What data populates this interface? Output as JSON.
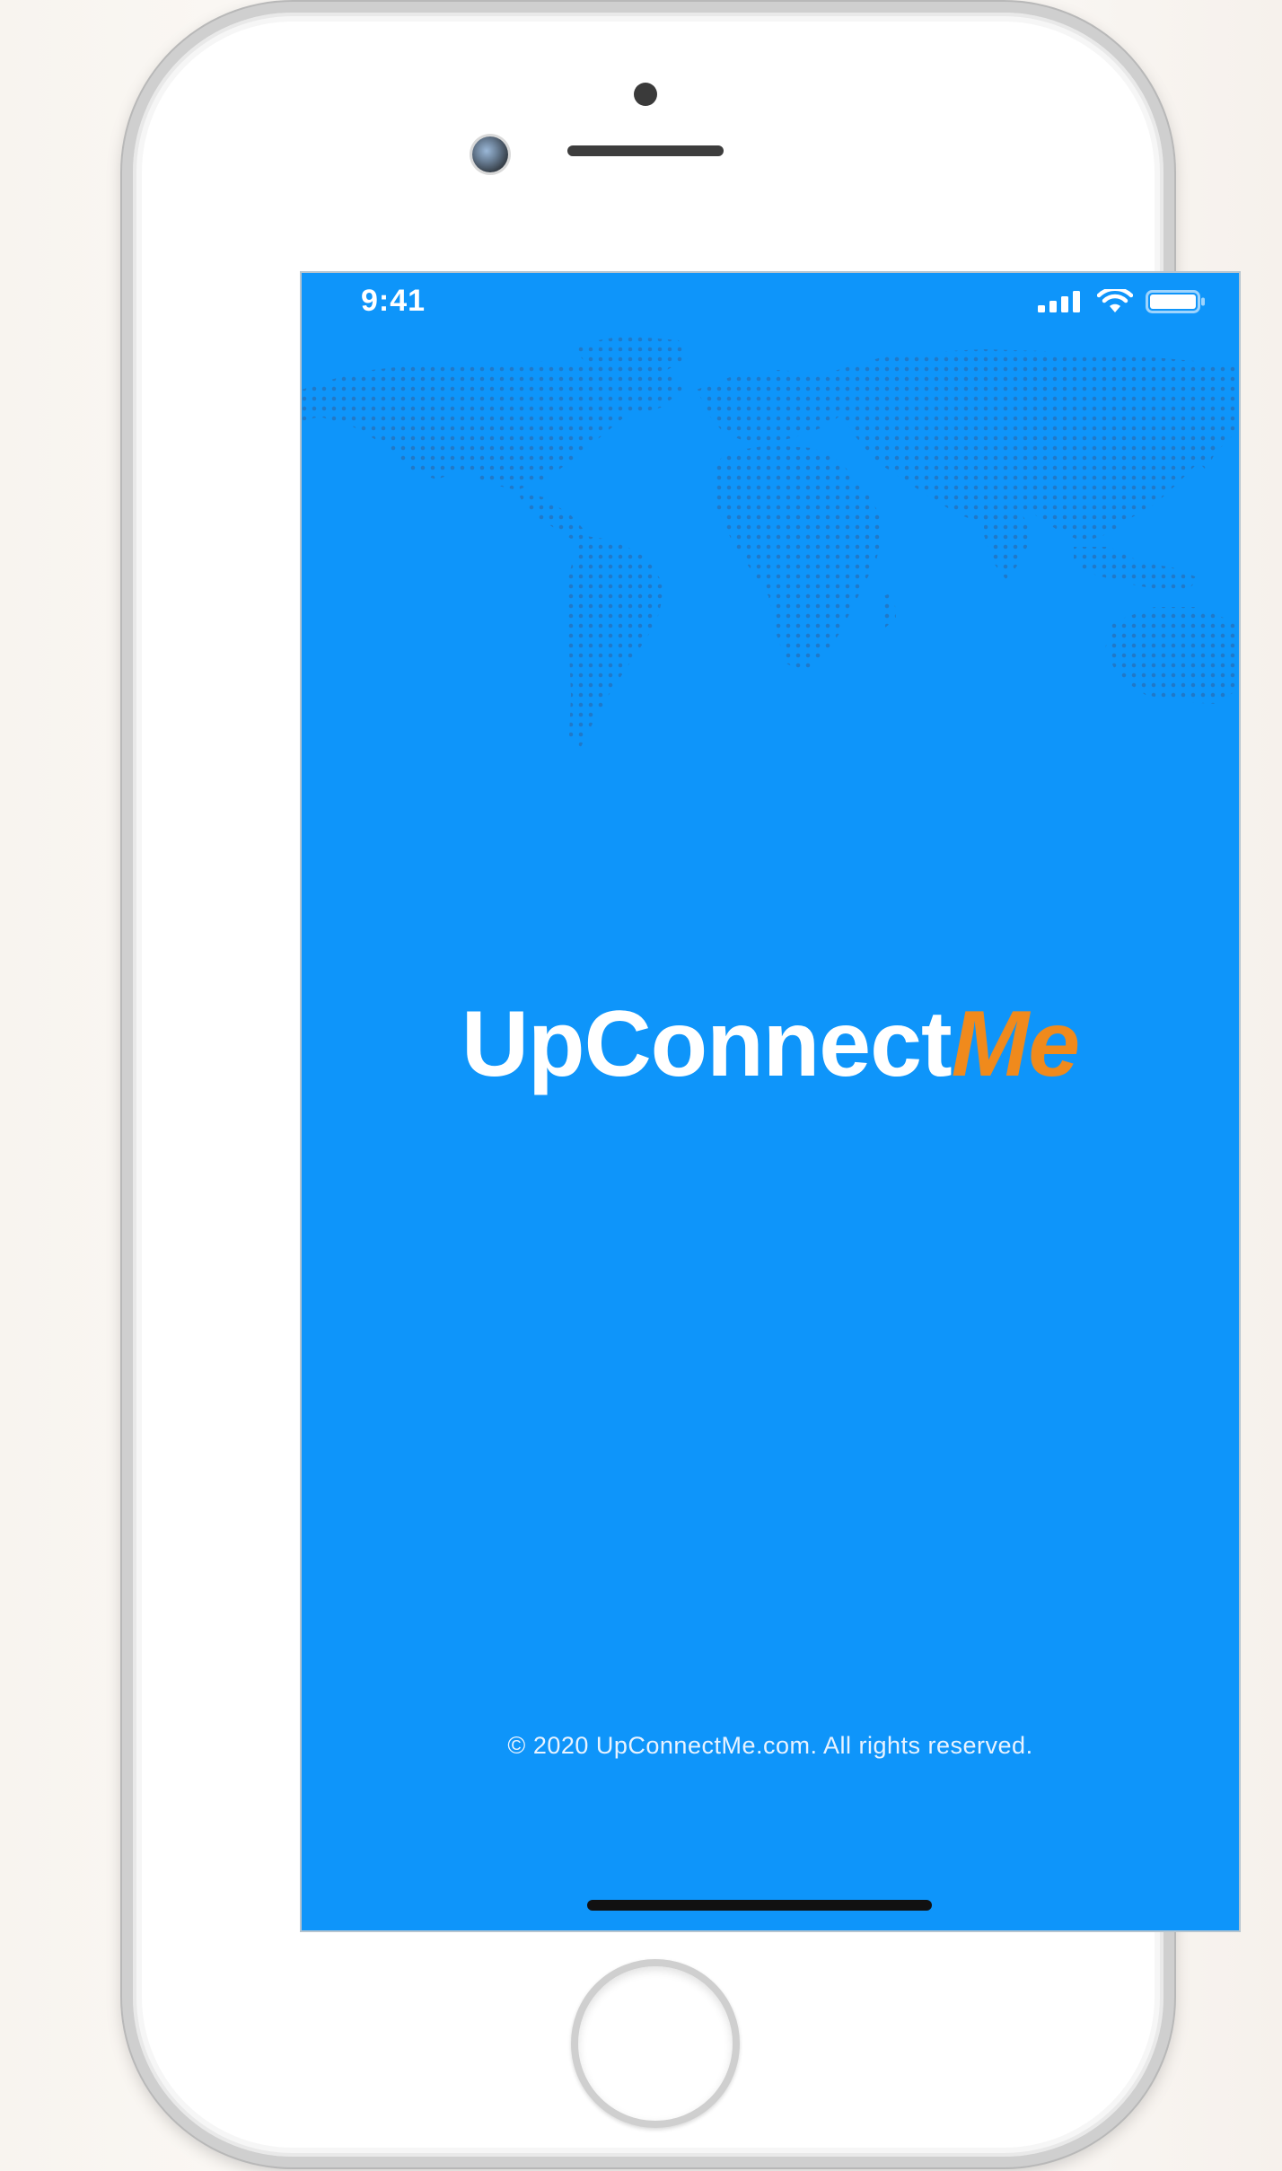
{
  "status_bar": {
    "time": "9:41"
  },
  "logo": {
    "main": "UpConnect",
    "accent": "Me",
    "accent_color": "#f08a1c"
  },
  "footer": {
    "copyright": "© 2020 UpConnectMe.com. All rights reserved."
  },
  "colors": {
    "screen_background": "#0e95fa",
    "map_dots": "#1f79c9"
  },
  "icons": [
    "signal-icon",
    "wifi-icon",
    "battery-icon"
  ]
}
